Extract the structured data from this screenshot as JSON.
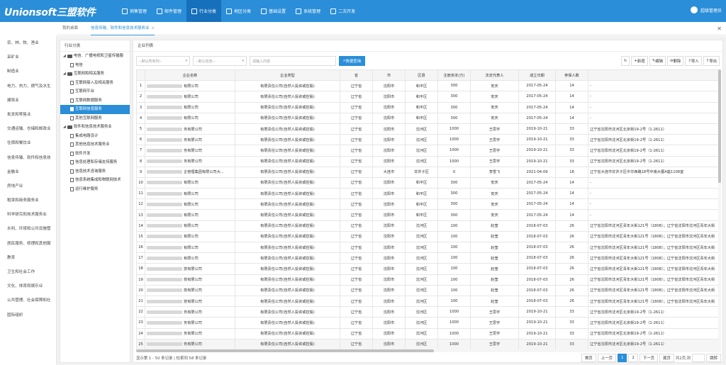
{
  "app": {
    "logo": "Unionsoft三盟软件"
  },
  "nav": [
    {
      "label": "销售管理",
      "icon": "sales-icon"
    },
    {
      "label": "邮件管理",
      "icon": "mail-icon"
    },
    {
      "label": "行业分类",
      "icon": "industry-icon"
    },
    {
      "label": "地区分类",
      "icon": "region-icon"
    },
    {
      "label": "基础设置",
      "icon": "settings-icon"
    },
    {
      "label": "系统管理",
      "icon": "system-icon"
    },
    {
      "label": "二次开发",
      "icon": "dev-icon"
    }
  ],
  "user": {
    "name": "超级管理员"
  },
  "tabs": {
    "home": "我的桌面",
    "current": "信息传输、软件和信息技术服务业",
    "close": "×"
  },
  "sidebar": [
    "农、林、牧、渔业",
    "采矿业",
    "制造业",
    "电力、热力、燃气及水生",
    "建筑业",
    "批发和零售业",
    "交通运输、仓储和邮政业",
    "住宿和餐饮业",
    "信息传输、软件和信息技",
    "金融业",
    "房地产业",
    "租赁和商务服务业",
    "科学研究和技术服务业",
    "水利、环境和公共设施管",
    "居民服务、修理和其他服",
    "教育",
    "卫生和社会工作",
    "文化、体育和娱乐业",
    "公共管理、社会保障和社",
    "国际组织"
  ],
  "tree": {
    "title": "行业分类",
    "nodes": [
      {
        "label": "电信、广播电视和卫星传输服",
        "level": 0,
        "type": "folder"
      },
      {
        "label": "电信",
        "level": 1,
        "type": "doc"
      },
      {
        "label": "互联网和相关服务",
        "level": 0,
        "type": "folder"
      },
      {
        "label": "互联网接入及相关服务",
        "level": 1,
        "type": "doc"
      },
      {
        "label": "互联网平台",
        "level": 1,
        "type": "doc"
      },
      {
        "label": "互联网数据服务",
        "level": 1,
        "type": "doc"
      },
      {
        "label": "互联网信息服务",
        "level": 1,
        "type": "doc",
        "selected": true
      },
      {
        "label": "其他互联网服务",
        "level": 1,
        "type": "doc"
      },
      {
        "label": "软件和信息技术服务业",
        "level": 0,
        "type": "folder"
      },
      {
        "label": "集成电路设计",
        "level": 1,
        "type": "doc"
      },
      {
        "label": "其他信息技术服务业",
        "level": 1,
        "type": "doc"
      },
      {
        "label": "软件开发",
        "level": 1,
        "type": "doc"
      },
      {
        "label": "信息处理和存储支持服务",
        "level": 1,
        "type": "doc"
      },
      {
        "label": "信息技术咨询服务",
        "level": 1,
        "type": "doc"
      },
      {
        "label": "信息系统集成和物联网技术",
        "level": 1,
        "type": "doc"
      },
      {
        "label": "运行维护服务",
        "level": 1,
        "type": "doc"
      }
    ]
  },
  "grid": {
    "title": "企业列表",
    "filter1": "--默认所有列--",
    "filter2": "--默认包含--",
    "search_placeholder": "请输入内容",
    "search_button": "快速查询",
    "toolbar": [
      {
        "label": "",
        "icon": "refresh-icon"
      },
      {
        "label": "新增",
        "icon": "plus-icon"
      },
      {
        "label": "编辑",
        "icon": "edit-icon"
      },
      {
        "label": "删除",
        "icon": "delete-icon"
      },
      {
        "label": "导入",
        "icon": "import-icon"
      },
      {
        "label": "导出",
        "icon": "export-icon"
      }
    ],
    "columns": [
      "",
      "企业名称",
      "企业类型",
      "省",
      "市",
      "区县",
      "注册资本(万)",
      "法定代表人",
      "成立日期",
      "参保人数",
      ""
    ],
    "rows": [
      [
        "1",
        "有限公司",
        "有限责任公司(自然人投资或控股)",
        "辽宁省",
        "沈阳市",
        "和平区",
        "300",
        "安庆",
        "2017-05-24",
        "14",
        "-"
      ],
      [
        "2",
        "有限公司",
        "有限责任公司(自然人投资或控股)",
        "辽宁省",
        "沈阳市",
        "和平区",
        "300",
        "安庆",
        "2017-05-24",
        "14",
        "-"
      ],
      [
        "3",
        "有限公司",
        "有限责任公司(自然人投资或控股)",
        "辽宁省",
        "沈阳市",
        "和平区",
        "300",
        "安庆",
        "2017-05-24",
        "14",
        "-"
      ],
      [
        "4",
        "有限公司",
        "有限责任公司(自然人投资或控股)",
        "辽宁省",
        "沈阳市",
        "和平区",
        "300",
        "安庆",
        "2017-05-24",
        "14",
        "-"
      ],
      [
        "5",
        "务有限公司",
        "有限责任公司(自然人投资或控股)",
        "辽宁省",
        "沈阳市",
        "沈河区",
        "1000",
        "王思宇",
        "2019-10-21",
        "33",
        "辽宁省沈阳市沈河区北京街19-2号（1-2611）"
      ],
      [
        "6",
        "务有限公司",
        "有限责任公司(自然人投资或控股)",
        "辽宁省",
        "沈阳市",
        "沈河区",
        "1000",
        "王思宇",
        "2019-10-21",
        "33",
        "辽宁省沈阳市沈河区北京街19-2号（1-2611）"
      ],
      [
        "7",
        "务有限公司",
        "有限责任公司(自然人投资或控股)",
        "辽宁省",
        "沈阳市",
        "沈河区",
        "1000",
        "王思宇",
        "2019-10-21",
        "33",
        "辽宁省沈阳市沈河区北京街19-2号（1-2611）"
      ],
      [
        "8",
        "务有限公司",
        "有限责任公司(自然人投资或控股)",
        "辽宁省",
        "沈阳市",
        "沈河区",
        "1000",
        "王思宇",
        "2019-10-21",
        "33",
        "辽宁省沈阳市沈河区北京街19-2号（1-2611）"
      ],
      [
        "9",
        "企管理集团有限公司大...",
        "有限责任公司(自然人投资或控股)",
        "辽宁省",
        "大连市",
        "甘井子区",
        "0",
        "李雪飞",
        "2021-04-09",
        "18",
        "辽宁省大连市甘井子区中华西路18号中南大厦A座1108室"
      ],
      [
        "10",
        "有限公司",
        "有限责任公司(自然人投资或控股)",
        "辽宁省",
        "沈阳市",
        "和平区",
        "300",
        "安庆",
        "2017-05-24",
        "14",
        "-"
      ],
      [
        "11",
        "有限公司",
        "有限责任公司(自然人投资或控股)",
        "辽宁省",
        "沈阳市",
        "和平区",
        "300",
        "安庆",
        "2017-05-24",
        "14",
        "-"
      ],
      [
        "12",
        "有限公司",
        "有限责任公司(自然人投资或控股)",
        "辽宁省",
        "沈阳市",
        "和平区",
        "300",
        "安庆",
        "2017-05-24",
        "14",
        "-"
      ],
      [
        "13",
        "有限公司",
        "有限责任公司(自然人投资或控股)",
        "辽宁省",
        "沈阳市",
        "和平区",
        "300",
        "安庆",
        "2017-05-24",
        "14",
        "-"
      ],
      [
        "14",
        "有限公司",
        "有限责任公司(自然人投资或控股)",
        "辽宁省",
        "沈阳市",
        "沈河区",
        "100",
        "赵莹",
        "2018-07-03",
        "26",
        "辽宁省沈阳市沈河区青年大街121号（1808）；辽宁省沈阳市沈河区青年大街"
      ],
      [
        "15",
        "有限公司",
        "有限责任公司(自然人投资或控股)",
        "辽宁省",
        "沈阳市",
        "沈河区",
        "100",
        "赵莹",
        "2018-07-03",
        "26",
        "辽宁省沈阳市沈河区青年大街121号（1808）；辽宁省沈阳市沈河区青年大街"
      ],
      [
        "16",
        "有限公司",
        "有限责任公司(自然人投资或控股)",
        "辽宁省",
        "沈阳市",
        "沈河区",
        "100",
        "赵莹",
        "2018-07-03",
        "26",
        "辽宁省沈阳市沈河区青年大街121号（1808）；辽宁省沈阳市沈河区青年大街"
      ],
      [
        "17",
        "有限公司",
        "有限责任公司(自然人投资或控股)",
        "辽宁省",
        "沈阳市",
        "沈河区",
        "100",
        "赵莹",
        "2018-07-03",
        "26",
        "辽宁省沈阳市沈河区青年大街121号（1808）；辽宁省沈阳市沈河区青年大街"
      ],
      [
        "18",
        "技有限公司",
        "有限责任公司(自然人投资或控股)",
        "辽宁省",
        "沈阳市",
        "沈河区",
        "100",
        "赵莹",
        "2018-07-03",
        "26",
        "辽宁省沈阳市沈河区青年大街121号（1808）；辽宁省沈阳市沈河区青年大街"
      ],
      [
        "19",
        "技有限公司",
        "有限责任公司(自然人投资或控股)",
        "辽宁省",
        "沈阳市",
        "沈河区",
        "100",
        "赵莹",
        "2018-07-03",
        "26",
        "辽宁省沈阳市沈河区青年大街121号（1808）；辽宁省沈阳市沈河区青年大街"
      ],
      [
        "20",
        "技有限公司",
        "有限责任公司(自然人投资或控股)",
        "辽宁省",
        "沈阳市",
        "沈河区",
        "100",
        "赵莹",
        "2018-07-03",
        "26",
        "辽宁省沈阳市沈河区青年大街121号（1808）；辽宁省沈阳市沈河区青年大街"
      ],
      [
        "21",
        "技有限公司",
        "有限责任公司(自然人投资或控股)",
        "辽宁省",
        "沈阳市",
        "沈河区",
        "100",
        "赵莹",
        "2018-07-03",
        "26",
        "辽宁省沈阳市沈河区青年大街121号（1808）；辽宁省沈阳市沈河区青年大街"
      ],
      [
        "22",
        "务有限公司",
        "有限责任公司(自然人投资或控股)",
        "辽宁省",
        "沈阳市",
        "沈河区",
        "1000",
        "王思宇",
        "2019-10-21",
        "33",
        "辽宁省沈阳市沈河区北京街19-2号（1-2611）"
      ],
      [
        "23",
        "务有限公司",
        "有限责任公司(自然人投资或控股)",
        "辽宁省",
        "沈阳市",
        "沈河区",
        "1000",
        "王思宇",
        "2019-10-21",
        "33",
        "辽宁省沈阳市沈河区北京街19-2号（1-2611）"
      ],
      [
        "24",
        "务有限公司",
        "有限责任公司(自然人投资或控股)",
        "辽宁省",
        "沈阳市",
        "沈河区",
        "1000",
        "王思宇",
        "2019-10-21",
        "33",
        "辽宁省沈阳市沈河区北京街19-2号（1-2611）"
      ],
      [
        "25",
        "务有限公司",
        "有限责任公司(自然人投资或控股)",
        "辽宁省",
        "沈阳市",
        "沈河区",
        "1000",
        "王思宇",
        "2019-10-21",
        "33",
        "辽宁省沈阳市沈河区北京街19-2号（1-2611）"
      ]
    ],
    "highlight_row": 24
  },
  "pagination": {
    "info": "显示第 1 - 50 条记录 | 检索到 58 条记录",
    "first": "首页",
    "prev": "上一页",
    "pages": [
      "1",
      "2"
    ],
    "current": "1",
    "next": "下一页",
    "last": "尾页",
    "total": "共2页,到",
    "go": "跳转"
  },
  "colors": {
    "primary": "#2a8ed8",
    "active_nav": "#1670bb"
  }
}
